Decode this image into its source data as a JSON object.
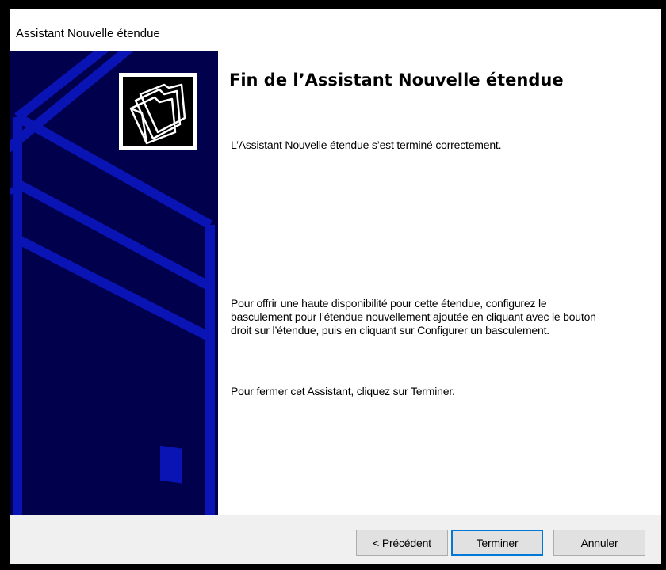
{
  "window": {
    "title": "Assistant Nouvelle étendue"
  },
  "side_panel": {
    "icon": "folders-icon",
    "background_color": "#01004d",
    "graphic_color": "#0a14b4"
  },
  "content": {
    "heading": "Fin de l’Assistant Nouvelle étendue",
    "completion_message": "L’Assistant Nouvelle étendue s’est terminé correctement.",
    "failover_message": "Pour offrir une haute disponibilité pour cette étendue, configurez le basculement pour l’étendue nouvellement ajoutée en cliquant avec le bouton droit sur l’étendue, puis en cliquant sur Configurer un basculement.",
    "close_message": "Pour fermer cet Assistant, cliquez sur Terminer."
  },
  "buttons": {
    "previous": "< Précédent",
    "finish": "Terminer",
    "cancel": "Annuler"
  }
}
